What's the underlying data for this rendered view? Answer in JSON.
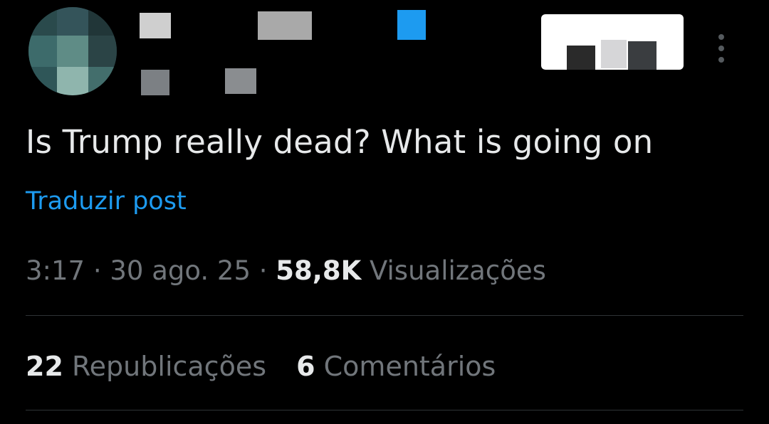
{
  "post": {
    "text": "Is Trump really dead? What is going on",
    "translate_label": "Traduzir post",
    "time": "3:17",
    "separator": "·",
    "date": "30 ago. 25",
    "views_count": "58,8K",
    "views_label": "Visualizações"
  },
  "stats": {
    "reposts_count": "22",
    "reposts_label": "Republicações",
    "comments_count": "6",
    "comments_label": "Comentários"
  },
  "icons": {
    "verified": "verified-badge-icon",
    "more": "more-options-icon"
  },
  "colors": {
    "background": "#000000",
    "text_primary": "#e7e9ea",
    "text_secondary": "#71767b",
    "link": "#1d9bf0",
    "divider": "#2f3336"
  }
}
